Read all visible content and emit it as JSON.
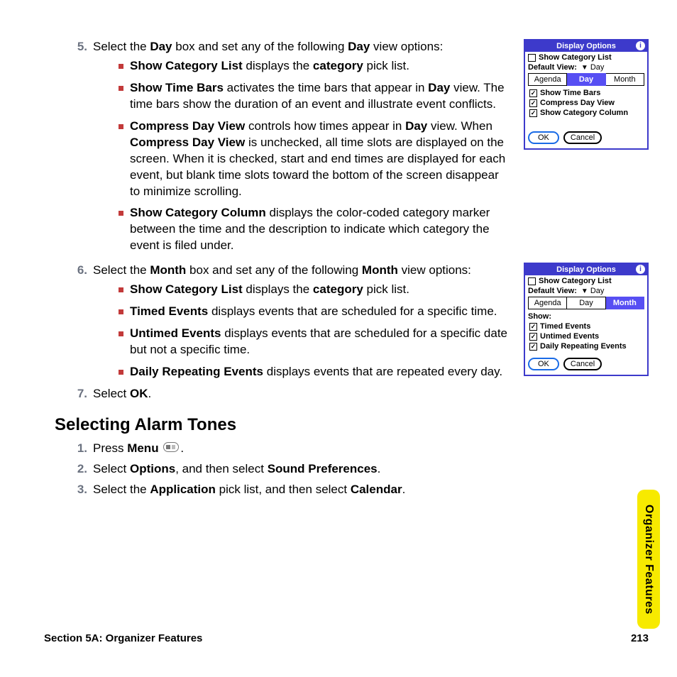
{
  "step5": {
    "num": "5.",
    "text_parts": [
      "Select the ",
      "Day",
      " box and set any of the following ",
      "Day",
      " view options:"
    ],
    "bullets": [
      {
        "b": "Show Category List",
        "rest": " displays the ",
        "b2": "category",
        "tail": " pick list."
      },
      {
        "b": "Show Time Bars",
        "rest": " activates the time bars that appear in ",
        "b2": "Day",
        "tail": " view. The time bars show the duration of an event and illustrate event conflicts."
      },
      {
        "b": "Compress Day View",
        "rest": " controls how times appear in ",
        "b2": "Day",
        "tail": " view. When ",
        "b3": "Compress Day View",
        "tail2": " is unchecked, all time slots are displayed on the screen. When it is checked, start and end times are displayed for each event, but blank time slots toward the bottom of the screen disappear to minimize scrolling."
      },
      {
        "b": "Show Category Column",
        "rest": " displays the color-coded category marker between the time and the description to indicate which category the event is filed under."
      }
    ]
  },
  "step6": {
    "num": "6.",
    "text_parts": [
      "Select the ",
      "Month",
      " box and set any of the following ",
      "Month",
      " view options:"
    ],
    "bullets": [
      {
        "b": "Show Category List",
        "rest": " displays the ",
        "b2": "category",
        "tail": " pick list."
      },
      {
        "b": "Timed Events",
        "rest": " displays events that are scheduled for a specific time."
      },
      {
        "b": "Untimed Events",
        "rest": " displays events that are scheduled for a specific date but not a specific time."
      },
      {
        "b": "Daily Repeating Events",
        "rest": " displays events that are repeated every day."
      }
    ]
  },
  "step7": {
    "num": "7.",
    "pre": "Select ",
    "b": "OK",
    "post": "."
  },
  "alarm": {
    "heading": "Selecting Alarm Tones",
    "s1": {
      "num": "1.",
      "pre": "Press ",
      "b": "Menu",
      "post": " ",
      "tail": "."
    },
    "s2": {
      "num": "2.",
      "pre": "Select ",
      "b": "Options",
      "mid": ", and then select ",
      "b2": "Sound Preferences",
      "post": "."
    },
    "s3": {
      "num": "3.",
      "pre": "Select the ",
      "b": "Application",
      "mid": " pick list, and then select ",
      "b2": "Calendar",
      "post": "."
    }
  },
  "footer": {
    "section": "Section 5A: Organizer Features",
    "page": "213"
  },
  "side_tab": "Organizer Features",
  "pda_day": {
    "title": "Display Options",
    "show_cat": "Show Category List",
    "default_view": "Default View:",
    "default_value": "Day",
    "tabs": [
      "Agenda",
      "Day",
      "Month"
    ],
    "active_tab": "Day",
    "options": [
      "Show Time Bars",
      "Compress Day View",
      "Show Category Column"
    ],
    "ok": "OK",
    "cancel": "Cancel"
  },
  "pda_month": {
    "title": "Display Options",
    "show_cat": "Show Category List",
    "default_view": "Default View:",
    "default_value": "Day",
    "tabs": [
      "Agenda",
      "Day",
      "Month"
    ],
    "active_tab": "Month",
    "show_label": "Show:",
    "options": [
      "Timed Events",
      "Untimed Events",
      "Daily Repeating Events"
    ],
    "ok": "OK",
    "cancel": "Cancel"
  }
}
